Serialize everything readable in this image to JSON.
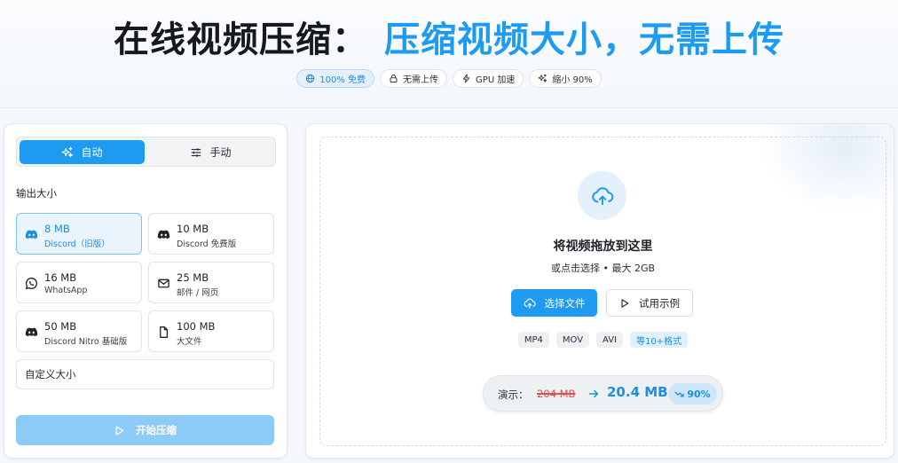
{
  "hero": {
    "title_dark": "在线视频压缩：",
    "title_blue": "压缩视频大小，无需上传",
    "badges": [
      {
        "label": "100% 免费",
        "icon": "globe-icon",
        "active": true
      },
      {
        "label": "无需上传",
        "icon": "lock-icon",
        "active": false
      },
      {
        "label": "GPU 加速",
        "icon": "bolt-icon",
        "active": false
      },
      {
        "label": "缩小 90%",
        "icon": "sparkles-icon",
        "active": false
      }
    ]
  },
  "mode": {
    "auto_label": "自动",
    "manual_label": "手动",
    "selected": "auto"
  },
  "output_size": {
    "label": "输出大小",
    "options": [
      {
        "value": "8 MB",
        "desc": "Discord（旧版）",
        "icon": "discord-icon",
        "selected": true
      },
      {
        "value": "10 MB",
        "desc": "Discord 免费版",
        "icon": "discord-icon",
        "selected": false
      },
      {
        "value": "16 MB",
        "desc": "WhatsApp",
        "icon": "whatsapp-icon",
        "selected": false
      },
      {
        "value": "25 MB",
        "desc": "邮件 / 网页",
        "icon": "mail-icon",
        "selected": false
      },
      {
        "value": "50 MB",
        "desc": "Discord Nitro 基础版",
        "icon": "discord-icon",
        "selected": false
      },
      {
        "value": "100 MB",
        "desc": "大文件",
        "icon": "file-icon",
        "selected": false
      }
    ],
    "custom_placeholder": "自定义大小"
  },
  "start_button": "开始压缩",
  "dropzone": {
    "title": "将视频拖放到这里",
    "subtitle": "或点击选择 • 最大 2GB",
    "select_button": "选择文件",
    "sample_button": "试用示例",
    "formats": [
      "MP4",
      "MOV",
      "AVI"
    ],
    "more_formats": "等10+格式"
  },
  "demo": {
    "label": "演示：",
    "before": "204 MB",
    "after": "20.4 MB",
    "reduction": "90%"
  },
  "colors": {
    "accent": "#1e9bf0",
    "accent_light": "#e4f1fc",
    "disabled_button": "#8ccbf6",
    "strike_red": "#d9534f"
  }
}
